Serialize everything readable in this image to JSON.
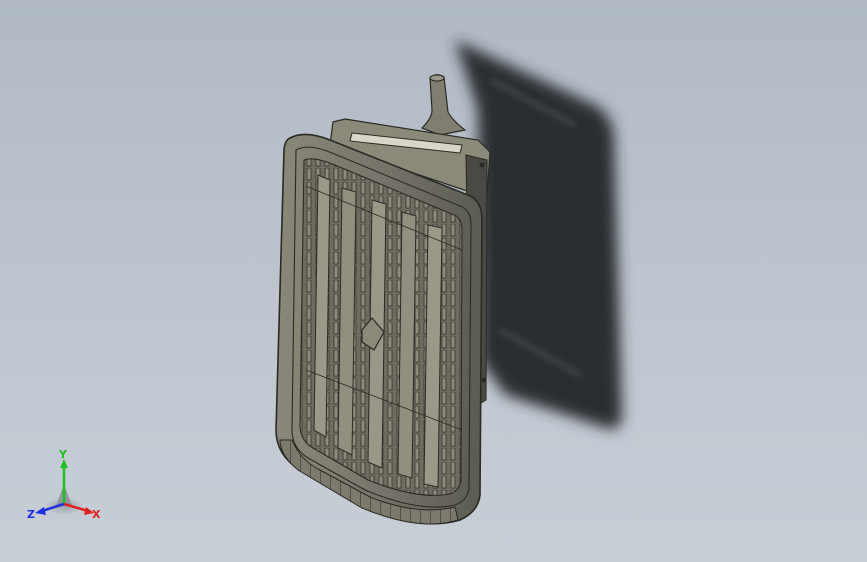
{
  "triad": {
    "x_label": "X",
    "y_label": "Y",
    "z_label": "Z",
    "x_color": "#e02020",
    "y_color": "#20c020",
    "z_color": "#2030e0"
  },
  "model": {
    "body_color": "#7a7868",
    "edge_color": "#2a2a24",
    "shadow_color": "#2b2d31"
  }
}
